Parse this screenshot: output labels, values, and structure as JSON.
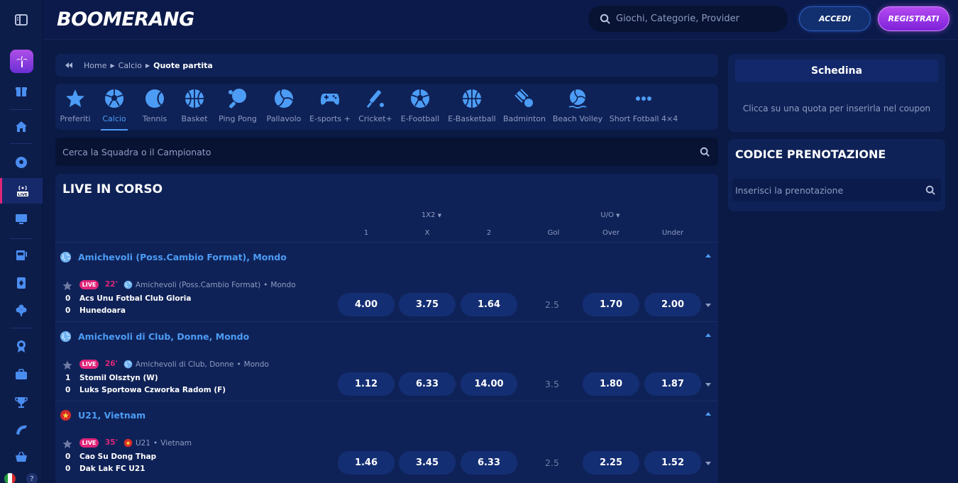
{
  "brand": {
    "logo_text": "BOOMERANG"
  },
  "header": {
    "search_placeholder": "Giochi, Categorie, Provider",
    "login_label": "ACCEDI",
    "register_label": "REGISTRATI"
  },
  "breadcrumb": {
    "items": [
      "Home",
      "Calcio"
    ],
    "current": "Quote partita"
  },
  "sports": [
    {
      "label": "Preferiti",
      "icon": "star-icon"
    },
    {
      "label": "Calcio",
      "icon": "football-icon"
    },
    {
      "label": "Tennis",
      "icon": "tennis-icon"
    },
    {
      "label": "Basket",
      "icon": "basketball-icon"
    },
    {
      "label": "Ping Pong",
      "icon": "ping-pong-icon"
    },
    {
      "label": "Pallavolo",
      "icon": "volleyball-icon"
    },
    {
      "label": "E-sports +",
      "icon": "gamepad-icon"
    },
    {
      "label": "Cricket+",
      "icon": "cricket-icon"
    },
    {
      "label": "E-Football",
      "icon": "football-icon"
    },
    {
      "label": "E-Basketball",
      "icon": "basketball-icon"
    },
    {
      "label": "Badminton",
      "icon": "shuttlecock-icon"
    },
    {
      "label": "Beach Volley",
      "icon": "beach-volley-icon"
    },
    {
      "label": "Short Fotball 4×4",
      "icon": "more-icon"
    }
  ],
  "active_sport": "Calcio",
  "search_main": {
    "placeholder": "Cerca la Squadra o il Campionato"
  },
  "live": {
    "title": "LIVE IN CORSO",
    "group_1x2": "1X2",
    "group_uo": "U/O",
    "col_1": "1",
    "col_x": "X",
    "col_2": "2",
    "col_gol": "Gol",
    "col_over": "Over",
    "col_under": "Under",
    "leagues": [
      {
        "name": "Amichevoli (Poss.Cambio Format), Mondo",
        "flag": "globe-icon",
        "match": {
          "live_label": "LIVE",
          "minute": "22'",
          "competition": "Amichevoli (Poss.Cambio Format)",
          "region": "Mondo",
          "home_score": "0",
          "home": "Acs Unu Fotbal Club Gloria",
          "away_score": "0",
          "away": "Hunedoara",
          "odd_1": "4.00",
          "odd_x": "3.75",
          "odd_2": "1.64",
          "gol": "2.5",
          "over": "1.70",
          "under": "2.00"
        }
      },
      {
        "name": "Amichevoli di Club, Donne, Mondo",
        "flag": "globe-icon",
        "match": {
          "live_label": "LIVE",
          "minute": "26'",
          "competition": "Amichevoli di Club, Donne",
          "region": "Mondo",
          "home_score": "1",
          "home": "Stomil Olsztyn (W)",
          "away_score": "0",
          "away": "Luks Sportowa Czworka Radom (F)",
          "odd_1": "1.12",
          "odd_x": "6.33",
          "odd_2": "14.00",
          "gol": "3.5",
          "over": "1.80",
          "under": "1.87"
        }
      },
      {
        "name": "U21, Vietnam",
        "flag": "vietnam-flag-icon",
        "match": {
          "live_label": "LIVE",
          "minute": "35'",
          "competition": "U21",
          "region": "Vietnam",
          "home_score": "0",
          "home": "Cao Su Dong Thap",
          "away_score": "0",
          "away": "Dak Lak FC U21",
          "odd_1": "1.46",
          "odd_x": "3.45",
          "odd_2": "6.33",
          "gol": "2.5",
          "over": "2.25",
          "under": "1.52"
        }
      }
    ]
  },
  "schedina": {
    "title": "Schedina",
    "empty_message": "Clicca su una quota per inserirla nel coupon"
  },
  "codice": {
    "title": "CODICE PRENOTAZIONE",
    "placeholder": "Inserisci la prenotazione"
  },
  "colors": {
    "accent": "#4c9cf5",
    "live": "#e0257a",
    "register": "#9b3be6"
  }
}
